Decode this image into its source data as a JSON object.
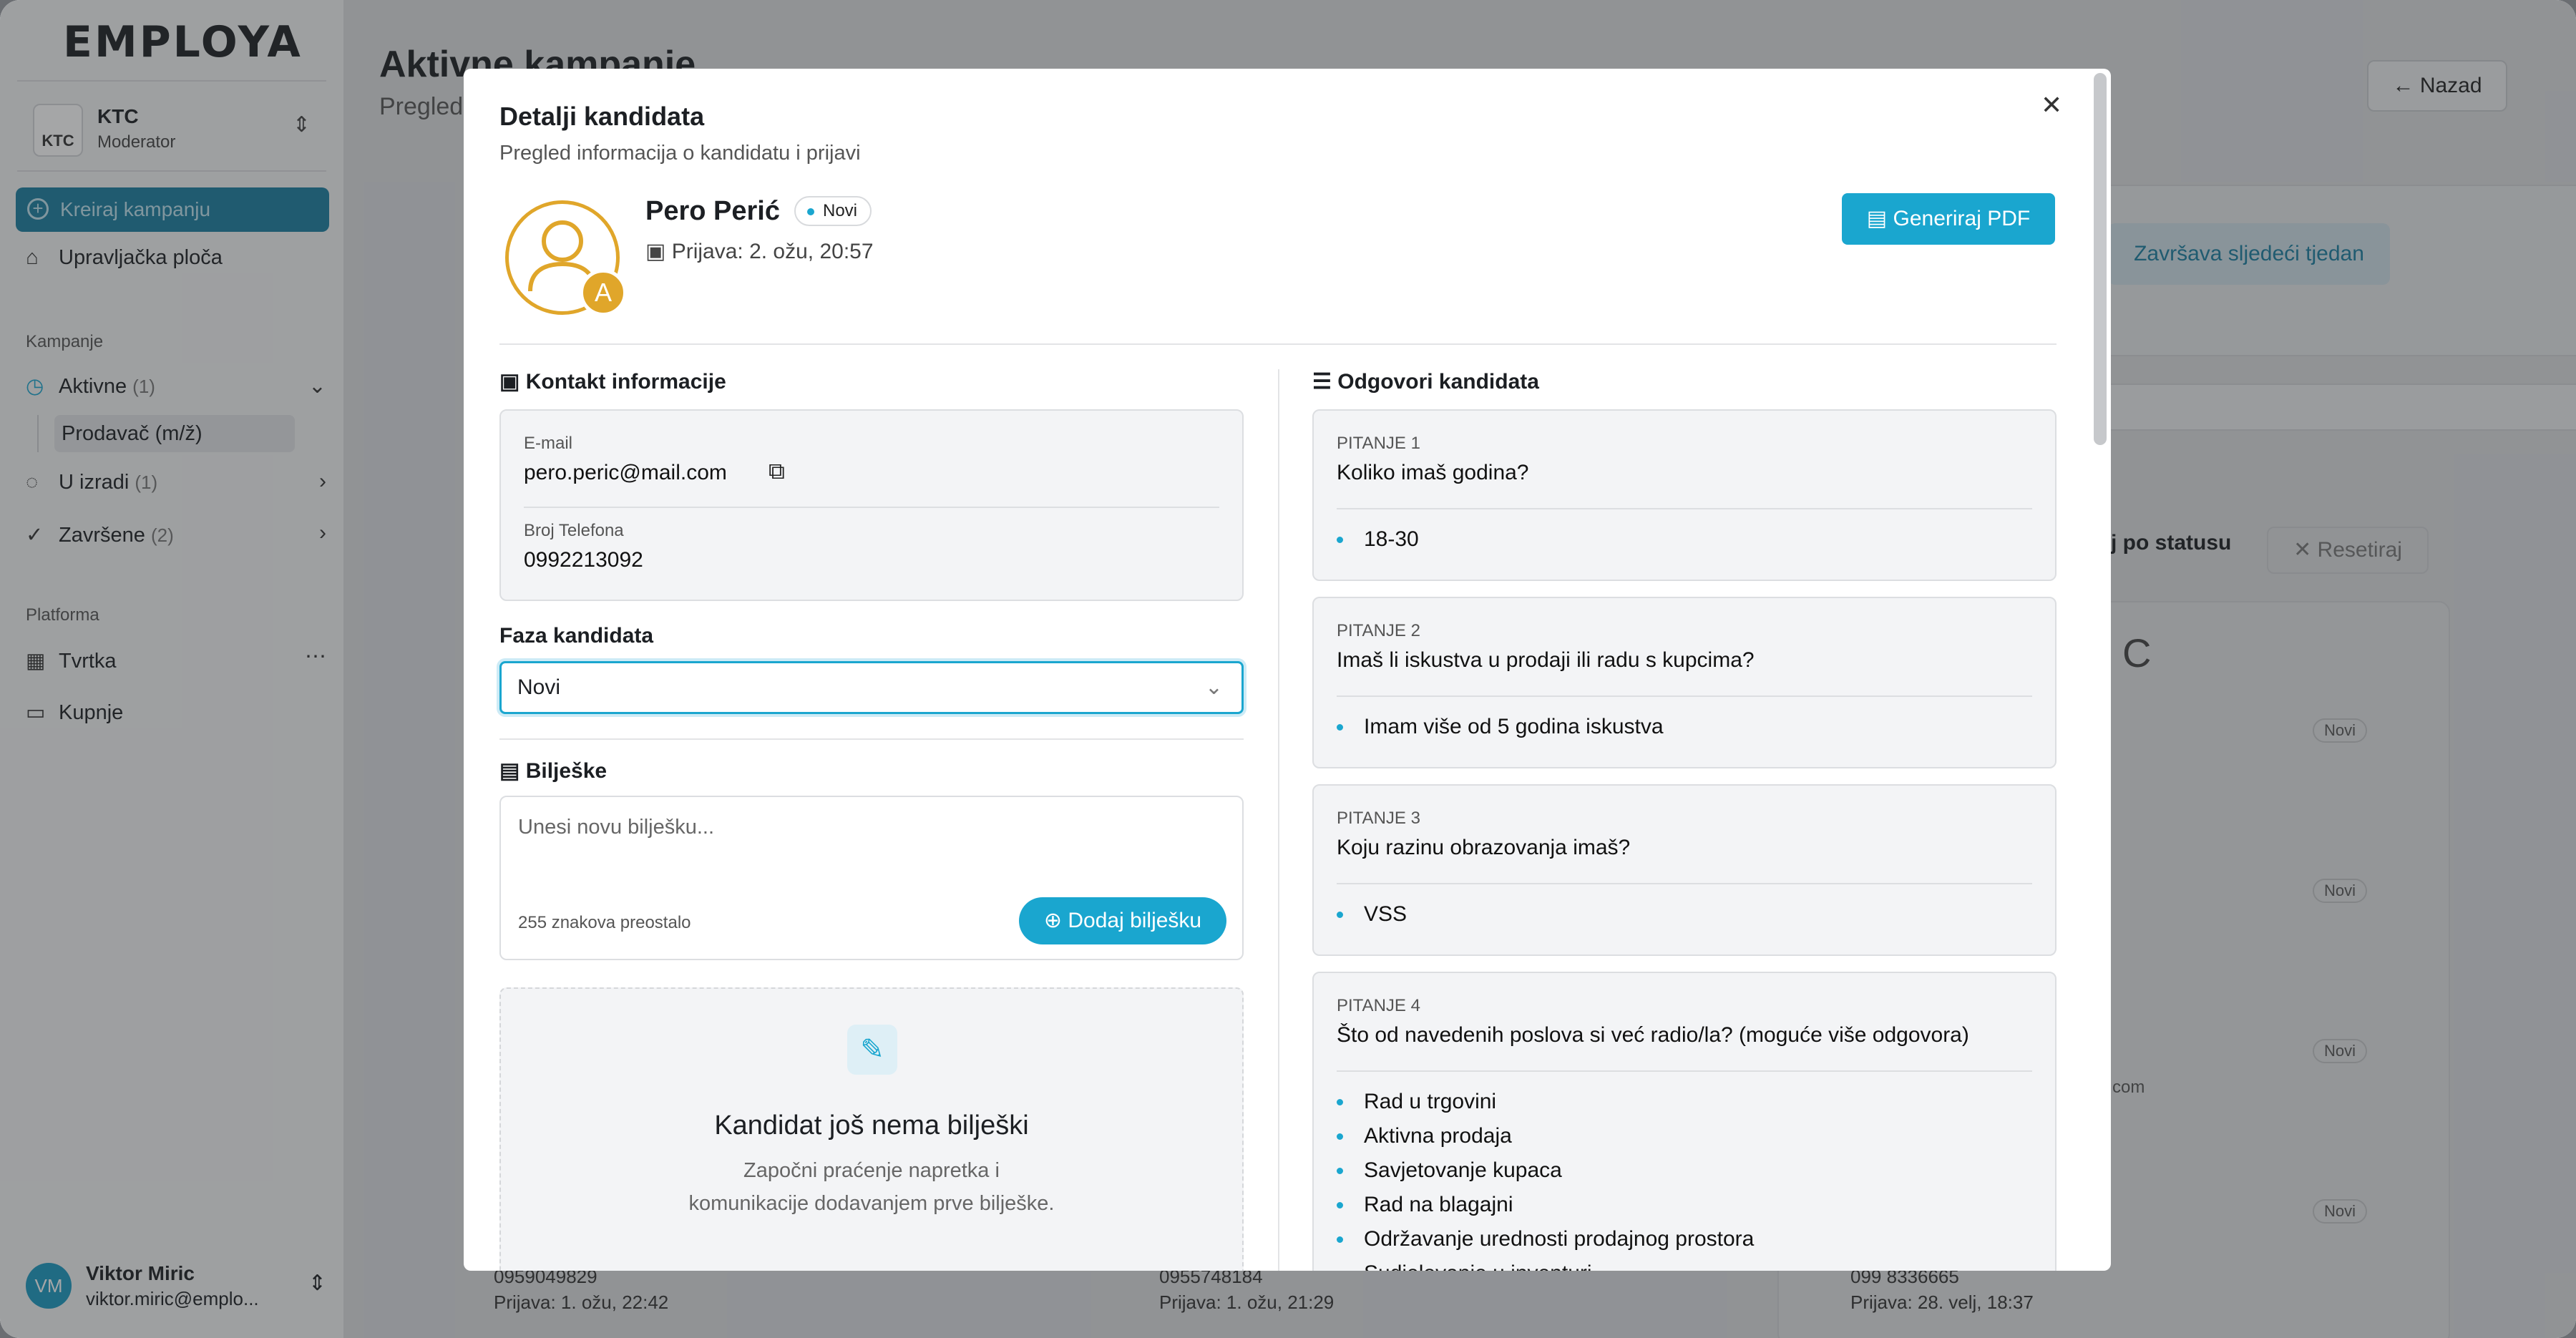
{
  "sidebar": {
    "logo": "EMPLOYA",
    "team": {
      "name": "KTC",
      "role": "Moderator"
    },
    "create_label": "Kreiraj kampanju",
    "dashboard_label": "Upravljačka ploča",
    "campaigns_section": "Kampanje",
    "active": {
      "label": "Aktivne",
      "count": "(1)"
    },
    "active_sub": "Prodavač (m/ž)",
    "draft": {
      "label": "U izradi",
      "count": "(1)"
    },
    "done": {
      "label": "Završene",
      "count": "(2)"
    },
    "platform_section": "Platforma",
    "company_label": "Tvrtka",
    "purchases_label": "Kupnje",
    "user": {
      "initials": "VM",
      "name": "Viktor Miric",
      "email": "viktor.miric@emplo..."
    }
  },
  "main": {
    "title": "Aktivne kampanje",
    "subtitle": "Pregled",
    "back_label": "Nazad",
    "finish_label": "Završava sljedeći tjedan",
    "filter_label": "j po statusu",
    "reset_label": "Resetiraj",
    "badges": [
      "Novi",
      "Novi",
      "Novi",
      "Novi"
    ],
    "letter": "C",
    "partial_email": "com",
    "bottom_cards": [
      {
        "phone": "0959049829",
        "date": "Prijava: 1. ožu, 22:42"
      },
      {
        "phone": "0955748184",
        "date": "Prijava: 1. ožu, 21:29"
      },
      {
        "phone": "099 8336665",
        "date": "Prijava: 28. velj, 18:37"
      }
    ]
  },
  "modal": {
    "title": "Detalji kandidata",
    "subtitle": "Pregled informacija o kandidatu i prijavi",
    "candidate": {
      "name": "Pero Perić",
      "status": "Novi",
      "applied": "Prijava: 2. ožu, 20:57",
      "avatar_letter": "A"
    },
    "pdf_label": "Generiraj PDF",
    "contact": {
      "heading": "Kontakt informacije",
      "email_label": "E-mail",
      "email": "pero.peric@mail.com",
      "phone_label": "Broj Telefona",
      "phone": "0992213092"
    },
    "phase": {
      "heading": "Faza kandidata",
      "value": "Novi"
    },
    "notes": {
      "heading": "Bilješke",
      "placeholder": "Unesi novu bilješku...",
      "remaining": "255 znakova preostalo",
      "add_label": "Dodaj bilješku",
      "empty_title": "Kandidat još nema bilješki",
      "empty_line1": "Započni praćenje napretka i",
      "empty_line2": "komunikacije dodavanjem prve bilješke."
    },
    "answers": {
      "heading": "Odgovori kandidata",
      "questions": [
        {
          "label": "PITANJE 1",
          "text": "Koliko imaš godina?",
          "answers": [
            "18-30"
          ]
        },
        {
          "label": "PITANJE 2",
          "text": "Imaš li iskustva u prodaji ili radu s kupcima?",
          "answers": [
            "Imam više od 5 godina iskustva"
          ]
        },
        {
          "label": "PITANJE 3",
          "text": "Koju razinu obrazovanja imaš?",
          "answers": [
            "VSS"
          ]
        },
        {
          "label": "PITANJE 4",
          "text": "Što od navedenih poslova si već radio/la? (moguće više odgovora)",
          "answers": [
            "Rad u trgovini",
            "Aktivna prodaja",
            "Savjetovanje kupaca",
            "Rad na blagajni",
            "Održavanje urednosti prodajnog prostora",
            "Sudjelovanje u inventuri"
          ]
        }
      ]
    }
  },
  "colors": {
    "accent": "#1aa6cf",
    "avatar": "#e0a62a"
  }
}
